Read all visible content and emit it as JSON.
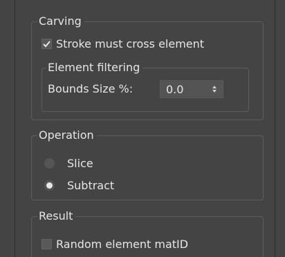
{
  "carving": {
    "title": "Carving",
    "stroke_must_cross": {
      "label": "Stroke must cross element",
      "checked": true
    },
    "element_filtering": {
      "title": "Element filtering",
      "bounds_size": {
        "label": "Bounds Size %:",
        "value": "0.0"
      }
    }
  },
  "operation": {
    "title": "Operation",
    "options": [
      {
        "label": "Slice",
        "selected": false
      },
      {
        "label": "Subtract",
        "selected": true
      }
    ]
  },
  "result": {
    "title": "Result",
    "random_matid": {
      "label": "Random element matID",
      "checked": false
    }
  },
  "colors": {
    "background": "#444444",
    "text": "#e6e6e6",
    "group_border": "#5e5e5e",
    "control_fill": "#555555"
  }
}
